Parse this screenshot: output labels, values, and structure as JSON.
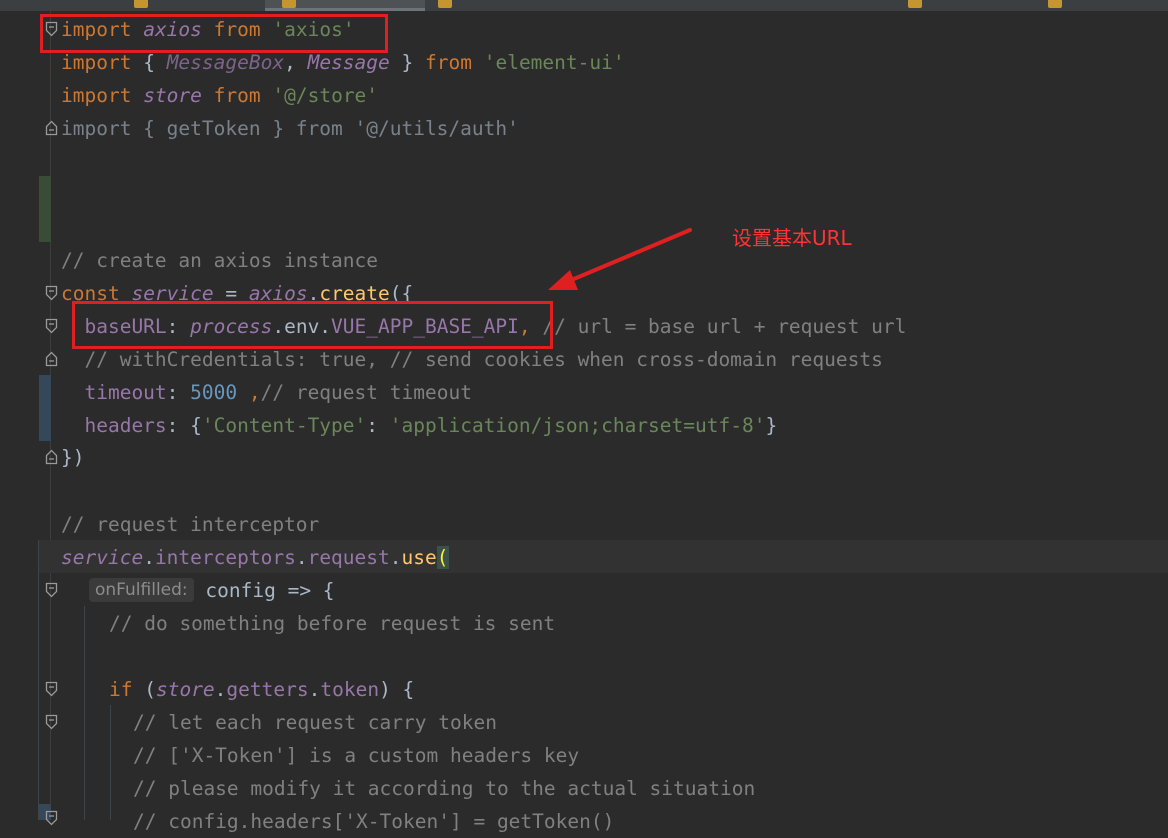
{
  "annotation": {
    "label": "设置基本URL"
  },
  "code": {
    "l1": {
      "kw1": "import",
      "id1": "axios",
      "kw2": "from",
      "s1": "'axios'"
    },
    "l2": {
      "kw1": "import",
      "p1": "{ ",
      "id1": "MessageBox",
      "p2": ", ",
      "id2": "Message",
      "p3": " } ",
      "kw2": "from",
      "s1": "'element-ui'"
    },
    "l3": {
      "kw1": "import",
      "id1": "store",
      "kw2": "from",
      "s1": "'@/store'"
    },
    "l4": {
      "text": "import { getToken } from '@/utils/auth'"
    },
    "l5": {
      "c": "// create an axios instance"
    },
    "l6": {
      "kw1": "const",
      "id1": "service",
      "p1": " = ",
      "id2": "axios",
      "p2": ".",
      "f1": "create",
      "p3": "({"
    },
    "l7": {
      "prop1": "baseURL",
      "p1": ": ",
      "id1": "process",
      "p2": ".env.",
      "prop2": "VUE_APP_BASE_API",
      "k1": ",",
      "c": "// url = base url + request url"
    },
    "l8": {
      "c": "// withCredentials: true, // send cookies when cross-domain requests"
    },
    "l9": {
      "prop1": "timeout",
      "p1": ": ",
      "n1": "5000",
      "k1": " ,",
      "c": "// request timeout"
    },
    "l10": {
      "prop1": "headers",
      "p1": ": {",
      "s1": "'Content-Type'",
      "p2": ": ",
      "s2": "'application/json;charset=utf-8'",
      "p3": "}"
    },
    "l11": {
      "p1": "})"
    },
    "l12": {
      "c": "// request interceptor"
    },
    "l13": {
      "id1": "service",
      "p1": ".",
      "prop1": "interceptors",
      "p2": ".",
      "prop2": "request",
      "p3": ".",
      "f1": "use",
      "paren": "("
    },
    "l14": {
      "hint": "onFulfilled:",
      "p1": " config => {"
    },
    "l15": {
      "c": "// do something before request is sent"
    },
    "l16": {
      "kw1": "if",
      "p1": " (",
      "id1": "store",
      "p2": ".",
      "prop1": "getters",
      "p3": ".",
      "prop2": "token",
      "p4": ") {"
    },
    "l17": {
      "c": "// let each request carry token"
    },
    "l18": {
      "c": "// ['X-Token'] is a custom headers key"
    },
    "l19": {
      "c": "// please modify it according to the actual situation"
    },
    "l20": {
      "c": "// config.headers['X-Token'] = getToken()"
    }
  }
}
